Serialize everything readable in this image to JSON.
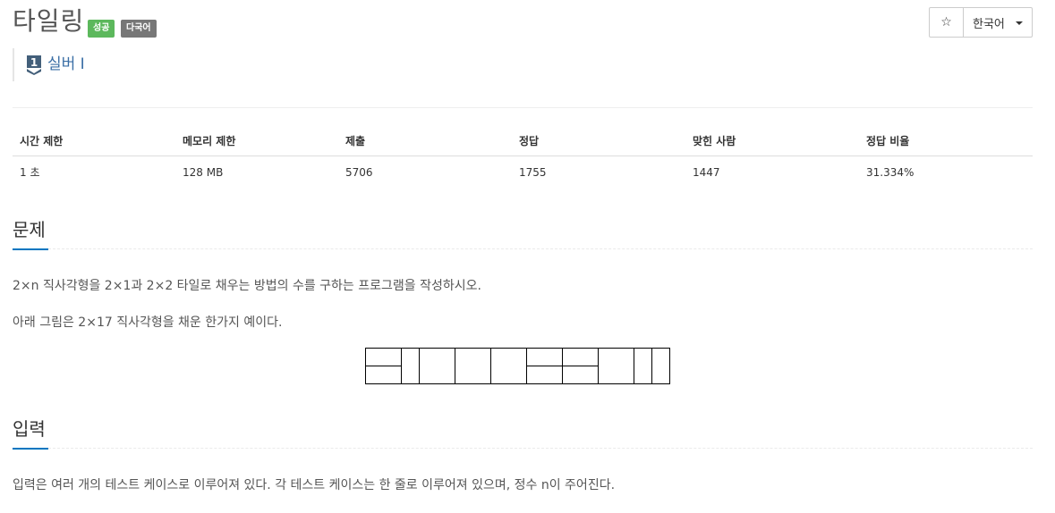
{
  "problem": {
    "title": "타일링",
    "badges": [
      {
        "label": "성공",
        "color": "#5cb85c"
      },
      {
        "label": "다국어",
        "color": "#777777"
      }
    ],
    "tier": {
      "icon": "silver-tier-icon",
      "icon_number": "1",
      "label": "실버 I"
    }
  },
  "toolbar": {
    "star_icon": "☆",
    "language": "한국어"
  },
  "stats": {
    "headers": [
      "시간 제한",
      "메모리 제한",
      "제출",
      "정답",
      "맞힌 사람",
      "정답 비율"
    ],
    "values": [
      "1 초",
      "128 MB",
      "5706",
      "1755",
      "1447",
      "31.334%"
    ]
  },
  "sections": {
    "problem": {
      "heading": "문제",
      "line1": "2×n 직사각형을 2×1과 2×2 타일로 채우는 방법의 수를 구하는 프로그램을 작성하시오.",
      "line2": "아래 그림은 2×17 직사각형을 채운 한가지 예이다."
    },
    "input": {
      "heading": "입력",
      "line1": "입력은 여러 개의 테스트 케이스로 이루어져 있다. 각 테스트 케이스는 한 줄로 이루어져 있으며, 정수 n이 주어진다."
    }
  }
}
